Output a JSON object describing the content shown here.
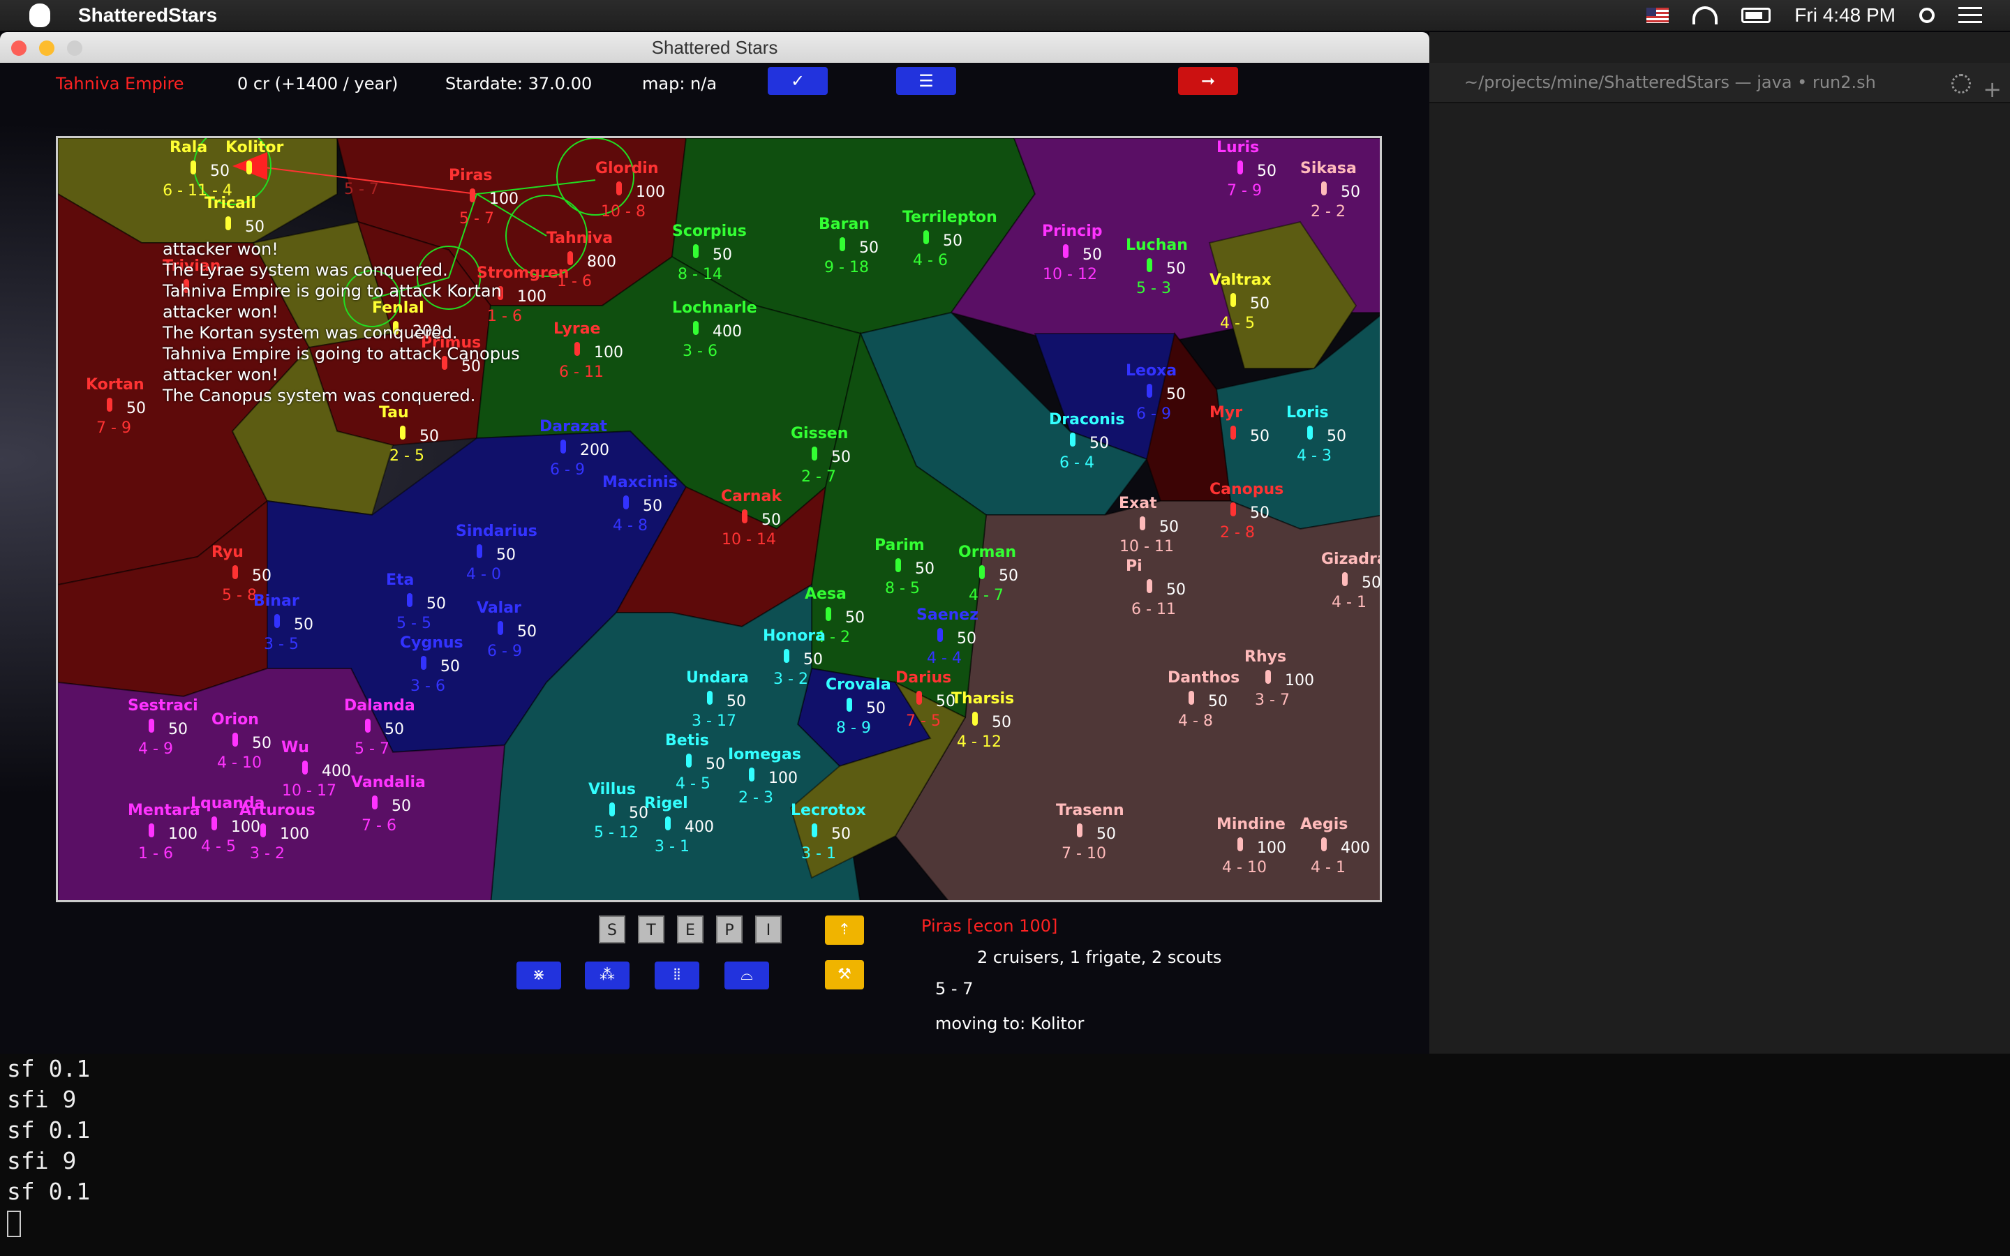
{
  "menubar": {
    "app_name": "ShatteredStars",
    "clock": "Fri 4:48 PM"
  },
  "window": {
    "title": "Shattered Stars"
  },
  "status": {
    "empire": "Tahniva Empire",
    "credits": "0 cr (+1400 / year)",
    "stardate": "Stardate: 37.0.00",
    "map": "map: n/a"
  },
  "colors": {
    "olive": "#5c5c12",
    "darkred": "#5e0a0a",
    "green": "#0f4f0f",
    "navy": "#10106a",
    "teal": "#0d4f52",
    "purple": "#5a0f65",
    "brown": "#4f3737",
    "maroon": "#3c0405"
  },
  "log": [
    "attacker won!",
    "The Lyrae system was conquered.",
    "Tahniva Empire is going to attack Kortan",
    "attacker won!",
    "The Kortan system was conquered.",
    "Tahniva Empire is going to attack Canopus",
    "attacker won!",
    "The Canopus system was conquered."
  ],
  "systems": [
    {
      "name": "Rala",
      "color": "#ffff33",
      "val": "50",
      "range": "6 - 11 - 4"
    },
    {
      "name": "Kolitor",
      "color": "#ffff33",
      "val": "",
      "range": ""
    },
    {
      "name": "Piras",
      "color": "#ff3333",
      "val": "100",
      "range": "5 - 7"
    },
    {
      "name": "Glordin",
      "color": "#ff3333",
      "val": "100",
      "range": "10 - 8"
    },
    {
      "name": "Tahniva",
      "color": "#ff3333",
      "val": "800",
      "range": "1 - 6"
    },
    {
      "name": "Tricall",
      "color": "#ffff33",
      "val": "50",
      "range": ""
    },
    {
      "name": "Trivian",
      "color": "#ff3333",
      "val": "",
      "range": ""
    },
    {
      "name": "Stromgren",
      "color": "#ff3333",
      "val": "100",
      "range": "1 - 6"
    },
    {
      "name": "Fenlal",
      "color": "#ffff33",
      "val": "200",
      "range": ""
    },
    {
      "name": "Primus",
      "color": "#ff3333",
      "val": "50",
      "range": ""
    },
    {
      "name": "Lyrae",
      "color": "#ff3333",
      "val": "100",
      "range": "6 - 11"
    },
    {
      "name": "Kortan",
      "color": "#ff3333",
      "val": "50",
      "range": "7 - 9"
    },
    {
      "name": "Tau",
      "color": "#ffff33",
      "val": "50",
      "range": "2 - 5"
    },
    {
      "name": "Scorpius",
      "color": "#33ff33",
      "val": "50",
      "range": "8 - 14"
    },
    {
      "name": "Lochnarle",
      "color": "#33ff33",
      "val": "400",
      "range": "3 - 6"
    },
    {
      "name": "Baran",
      "color": "#33ff33",
      "val": "50",
      "range": "9 - 18"
    },
    {
      "name": "Terrilepton",
      "color": "#33ff33",
      "val": "50",
      "range": "4 - 6"
    },
    {
      "name": "Princip",
      "color": "#ff33ff",
      "val": "50",
      "range": "10 - 12"
    },
    {
      "name": "Luchan",
      "color": "#33ff33",
      "val": "50",
      "range": "5 - 3"
    },
    {
      "name": "Luris",
      "color": "#ff33ff",
      "val": "50",
      "range": "7 - 9"
    },
    {
      "name": "Sikasa",
      "color": "#ffbbbb",
      "val": "50",
      "range": "2 - 2"
    },
    {
      "name": "Valtrax",
      "color": "#ffff33",
      "val": "50",
      "range": "4 - 5"
    },
    {
      "name": "Leoxa",
      "color": "#3333ff",
      "val": "50",
      "range": "6 - 9"
    },
    {
      "name": "Myr",
      "color": "#ff3333",
      "val": "50",
      "range": ""
    },
    {
      "name": "Loris",
      "color": "#33ffff",
      "val": "50",
      "range": "4 - 3"
    },
    {
      "name": "Draconis",
      "color": "#33ffff",
      "val": "50",
      "range": "6 - 4"
    },
    {
      "name": "Darazat",
      "color": "#3333ff",
      "val": "200",
      "range": "6 - 9"
    },
    {
      "name": "Gissen",
      "color": "#33ff33",
      "val": "50",
      "range": "2 - 7"
    },
    {
      "name": "Carnak",
      "color": "#ff3333",
      "val": "50",
      "range": "10 - 14"
    },
    {
      "name": "Maxcinis",
      "color": "#3333ff",
      "val": "50",
      "range": "4 - 8"
    },
    {
      "name": "Sindarius",
      "color": "#3333ff",
      "val": "50",
      "range": "4 - 0"
    },
    {
      "name": "Ryu",
      "color": "#ff3333",
      "val": "50",
      "range": "5 - 8"
    },
    {
      "name": "Binar",
      "color": "#3333ff",
      "val": "50",
      "range": "3 - 5"
    },
    {
      "name": "Eta",
      "color": "#3333ff",
      "val": "50",
      "range": "5 - 5"
    },
    {
      "name": "Valar",
      "color": "#3333ff",
      "val": "50",
      "range": "6 - 9"
    },
    {
      "name": "Cygnus",
      "color": "#3333ff",
      "val": "50",
      "range": "3 - 6"
    },
    {
      "name": "Exat",
      "color": "#ffbbbb",
      "val": "50",
      "range": "10 - 11"
    },
    {
      "name": "Canopus",
      "color": "#ff3333",
      "val": "50",
      "range": "2 - 8"
    },
    {
      "name": "Pi",
      "color": "#ffbbbb",
      "val": "50",
      "range": "6 - 11"
    },
    {
      "name": "Gizadra",
      "color": "#ffbbbb",
      "val": "50",
      "range": "4 - 1"
    },
    {
      "name": "Parim",
      "color": "#33ff33",
      "val": "50",
      "range": "8 - 5"
    },
    {
      "name": "Orman",
      "color": "#33ff33",
      "val": "50",
      "range": "4 - 7"
    },
    {
      "name": "Aesa",
      "color": "#33ff33",
      "val": "50",
      "range": "4 - 2"
    },
    {
      "name": "Honora",
      "color": "#33ffff",
      "val": "50",
      "range": "3 - 2"
    },
    {
      "name": "Saenez",
      "color": "#3333ff",
      "val": "50",
      "range": "4 - 4"
    },
    {
      "name": "Rhys",
      "color": "#ffbbbb",
      "val": "100",
      "range": "3 - 7"
    },
    {
      "name": "Danthos",
      "color": "#ffbbbb",
      "val": "50",
      "range": "4 - 8"
    },
    {
      "name": "Sestraci",
      "color": "#ff33ff",
      "val": "50",
      "range": "4 - 9"
    },
    {
      "name": "Orion",
      "color": "#ff33ff",
      "val": "50",
      "range": "4 - 10"
    },
    {
      "name": "Dalanda",
      "color": "#ff33ff",
      "val": "50",
      "range": "5 - 7"
    },
    {
      "name": "Wu",
      "color": "#ff33ff",
      "val": "400",
      "range": "10 - 17"
    },
    {
      "name": "Undara",
      "color": "#33ffff",
      "val": "50",
      "range": "3 - 17"
    },
    {
      "name": "Crovala",
      "color": "#33ffff",
      "val": "50",
      "range": "8 - 9"
    },
    {
      "name": "Darius",
      "color": "#ff3333",
      "val": "50",
      "range": "7 - 5"
    },
    {
      "name": "Tharsis",
      "color": "#ffff33",
      "val": "50",
      "range": "4 - 12"
    },
    {
      "name": "Betis",
      "color": "#33ffff",
      "val": "50",
      "range": "4 - 5"
    },
    {
      "name": "Iomegas",
      "color": "#33ffff",
      "val": "100",
      "range": "2 - 3"
    },
    {
      "name": "Vandalia",
      "color": "#ff33ff",
      "val": "50",
      "range": "7 - 6"
    },
    {
      "name": "Mentara",
      "color": "#ff33ff",
      "val": "100",
      "range": "1 - 6"
    },
    {
      "name": "Lquanda",
      "color": "#ff33ff",
      "val": "100",
      "range": "4 - 5"
    },
    {
      "name": "Arturous",
      "color": "#ff33ff",
      "val": "100",
      "range": "3 - 2"
    },
    {
      "name": "Villus",
      "color": "#33ffff",
      "val": "50",
      "range": "5 - 12"
    },
    {
      "name": "Rigel",
      "color": "#33ffff",
      "val": "400",
      "range": "3 - 1"
    },
    {
      "name": "Lecrotox",
      "color": "#33ffff",
      "val": "50",
      "range": "3 - 1"
    },
    {
      "name": "Trasenn",
      "color": "#ffbbbb",
      "val": "50",
      "range": "7 - 10"
    },
    {
      "name": "Mindine",
      "color": "#ffbbbb",
      "val": "100",
      "range": "4 - 10"
    },
    {
      "name": "Aegis",
      "color": "#ffbbbb",
      "val": "400",
      "range": "4 - 1"
    }
  ],
  "fleet_route": {
    "label": "5 - 7"
  },
  "controls": {
    "step_buttons": [
      "S",
      "T",
      "E",
      "P",
      "I"
    ],
    "ship_buttons": [
      "cruiser-group",
      "scout-pair",
      "fleet-row",
      "dome"
    ],
    "up_icon": "up-arrow-icon",
    "build_icon": "hammer-icon"
  },
  "info": {
    "title": "Piras [econ 100]",
    "fleet": "2 cruisers, 1 frigate, 2 scouts",
    "fleet_range": "5 - 7",
    "destination": "moving to: Kolitor"
  },
  "terminal_tab": {
    "title": "~/projects/mine/ShatteredStars — java • run2.sh"
  },
  "terminal_lines": [
    "sf 0.1",
    "sfi 9",
    "sf 0.1",
    "sfi 9",
    "sf 0.1"
  ]
}
